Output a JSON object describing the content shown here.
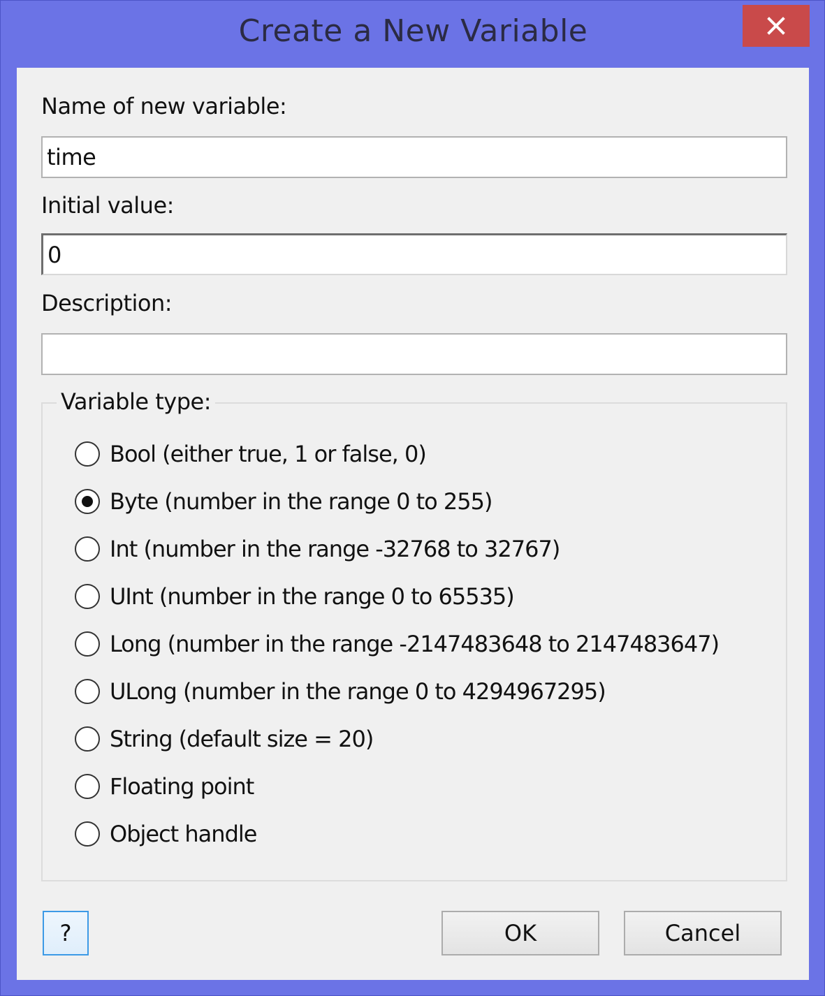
{
  "window": {
    "title": "Create a New Variable",
    "accent_color": "#6b73e6",
    "close_color": "#c94a4a"
  },
  "form": {
    "name_label": "Name of new variable:",
    "name_value": "time",
    "initial_label": "Initial value:",
    "initial_value": "0",
    "description_label": "Description:",
    "description_value": ""
  },
  "variable_type": {
    "legend": "Variable type:",
    "selected_index": 1,
    "options": [
      {
        "label": "Bool (either true, 1 or false, 0)"
      },
      {
        "label": "Byte (number in the range 0 to 255)"
      },
      {
        "label": "Int (number in the range -32768 to 32767)"
      },
      {
        "label": "UInt (number in the range 0 to 65535)"
      },
      {
        "label": "Long (number in the range -2147483648 to 2147483647)"
      },
      {
        "label": "ULong (number in the range 0 to 4294967295)"
      },
      {
        "label": "String (default size = 20)"
      },
      {
        "label": "Floating point"
      },
      {
        "label": "Object handle"
      }
    ]
  },
  "buttons": {
    "help_label": "?",
    "ok_label": "OK",
    "cancel_label": "Cancel"
  },
  "icons": {
    "close": "close-icon"
  }
}
